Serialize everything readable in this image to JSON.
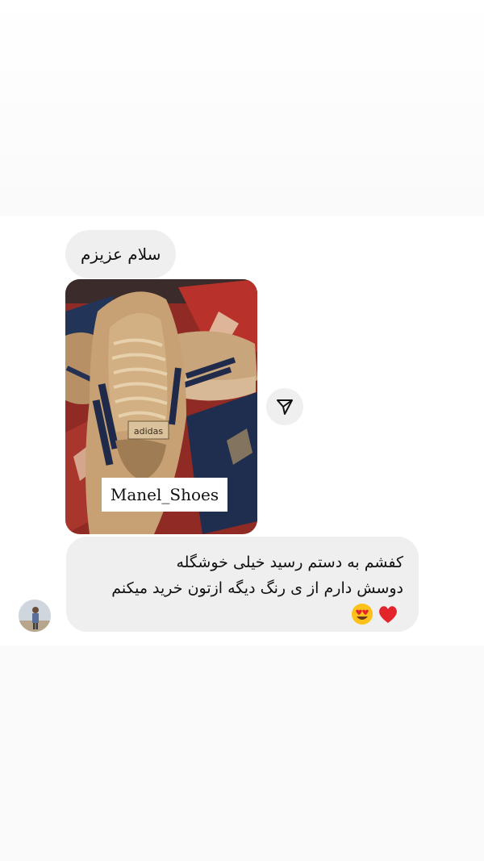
{
  "chat": {
    "greeting_text": "سلام عزیزم",
    "photo": {
      "watermark": "Manel_Shoes",
      "shoe_brand_text": "adidas"
    },
    "message": {
      "line1": "کفشم به دستم رسید خیلی خوشگله",
      "line2": "دوسش دارم از ی رنگ دیگه ازتون خرید میکنم",
      "emojis": [
        "heart-eyes-emoji",
        "red-heart-emoji"
      ]
    },
    "share_icon": "send-icon",
    "avatar_icon": "user-avatar"
  },
  "colors": {
    "bubble": "#efefef",
    "background": "#ffffff",
    "heart": "#e3242b",
    "emoji_face": "#fcc21b"
  }
}
